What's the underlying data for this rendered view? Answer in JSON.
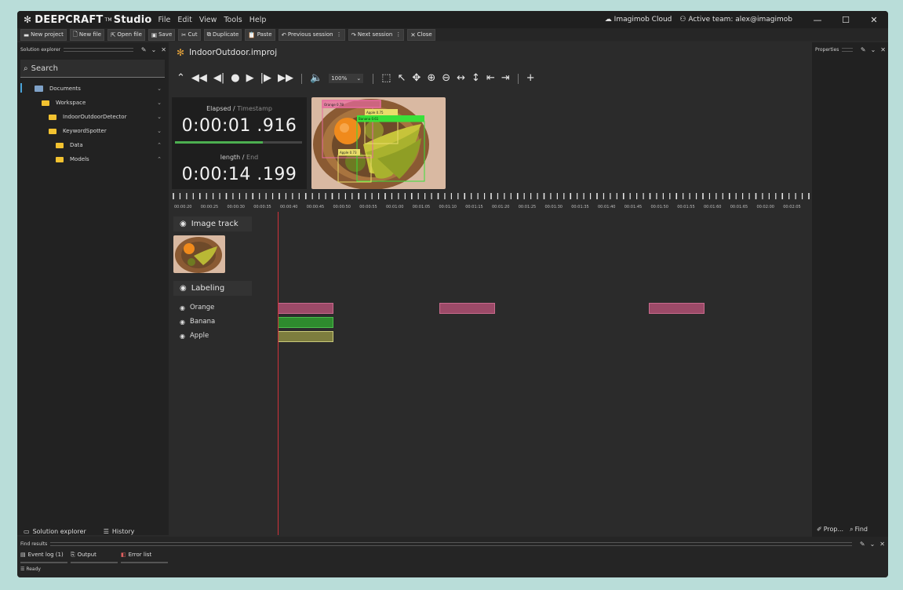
{
  "app": {
    "logo_icon": "asterisk-logo",
    "brand_name": "DEEPCRAFT",
    "brand_tm": "TM",
    "brand_suffix": "Studio",
    "menu": [
      "File",
      "Edit",
      "View",
      "Tools",
      "Help"
    ],
    "cloud_label": "Imagimob Cloud",
    "active_team": "Active team: alex@imagimob",
    "window_buttons": [
      "minimize-icon",
      "maximize-icon",
      "close-icon"
    ]
  },
  "toolbar": [
    {
      "name": "new-project-button",
      "icon": "folder-icon",
      "label": "New project"
    },
    {
      "name": "new-file-button",
      "icon": "new-file-icon",
      "label": "New file"
    },
    {
      "name": "open-file-button",
      "icon": "open-file-icon",
      "label": "Open file"
    },
    {
      "name": "save-button",
      "icon": "save-icon",
      "label": "Save"
    },
    {
      "name": "cut-button",
      "icon": "cut-icon",
      "label": "Cut"
    },
    {
      "name": "duplicate-button",
      "icon": "duplicate-icon",
      "label": "Duplicate"
    },
    {
      "name": "paste-button",
      "icon": "paste-icon",
      "label": "Paste"
    },
    {
      "name": "previous-session-button",
      "icon": "undo-arrow-icon",
      "label": "Previous session"
    },
    {
      "name": "next-session-button",
      "icon": "redo-arrow-icon",
      "label": "Next session"
    },
    {
      "name": "close-button",
      "icon": "close-icon",
      "label": "Close"
    }
  ],
  "solution_explorer": {
    "header": "Solution explorer",
    "search_placeholder": "Search",
    "tree": [
      {
        "label": "Documents",
        "icon": "documents-icon"
      },
      {
        "label": "Workspace",
        "icon": "folder-icon"
      },
      {
        "label": "IndoorOutdoorDetector",
        "icon": "folder-icon"
      },
      {
        "label": "KeywordSpotter",
        "icon": "folder-icon"
      },
      {
        "label": "Data",
        "icon": "folder-icon"
      },
      {
        "label": "Models",
        "icon": "folder-icon"
      }
    ],
    "bottom_tabs": [
      "Solution explorer",
      "History"
    ]
  },
  "editor": {
    "tab_title": "IndoorOutdoor.improj",
    "zoom": "100%",
    "elapsed_label": "Elapsed",
    "timestamp_label": "Timestamp",
    "elapsed_value": "0:00:01 .916",
    "length_label": "length",
    "end_label": "End",
    "length_value": "0:00:14 .199",
    "progress_fraction": 0.69,
    "detections": [
      "Orange 0.78",
      "Apple 0.75",
      "Banana 0.61",
      "Apple 0.73"
    ],
    "ruler_ticks": [
      "00:00:20",
      "00:00:25",
      "00:00:30",
      "00:00:35",
      "00:00:40",
      "00:00:45",
      "00:00:50",
      "00:00:55",
      "00:01:00",
      "00:01:05",
      "00:01:10",
      "00:01:15",
      "00:01:20",
      "00:01:25",
      "00:01:30",
      "00:01:35",
      "00:01:40",
      "00:01:45",
      "00:01:50",
      "00:01:55",
      "00:01:60",
      "00:01:65",
      "00:02:00",
      "00:02:05"
    ],
    "image_track_label": "Image track",
    "labeling_label": "Labeling",
    "labels": [
      {
        "name": "Orange",
        "color": "#b0506e"
      },
      {
        "name": "Banana",
        "color": "#2e8b2e"
      },
      {
        "name": "Apple",
        "color": "#9a9a4e"
      }
    ]
  },
  "properties": {
    "header": "Properties",
    "bottom_tabs": [
      "Prop...",
      "Find"
    ]
  },
  "bottom_panel": {
    "header": "Find results",
    "tabs": [
      "Event log (1)",
      "Output",
      "Error list"
    ],
    "status": "Ready"
  },
  "colors": {
    "accent_green": "#4caf50",
    "playhead": "#d0323c",
    "folder": "#f2c230"
  }
}
